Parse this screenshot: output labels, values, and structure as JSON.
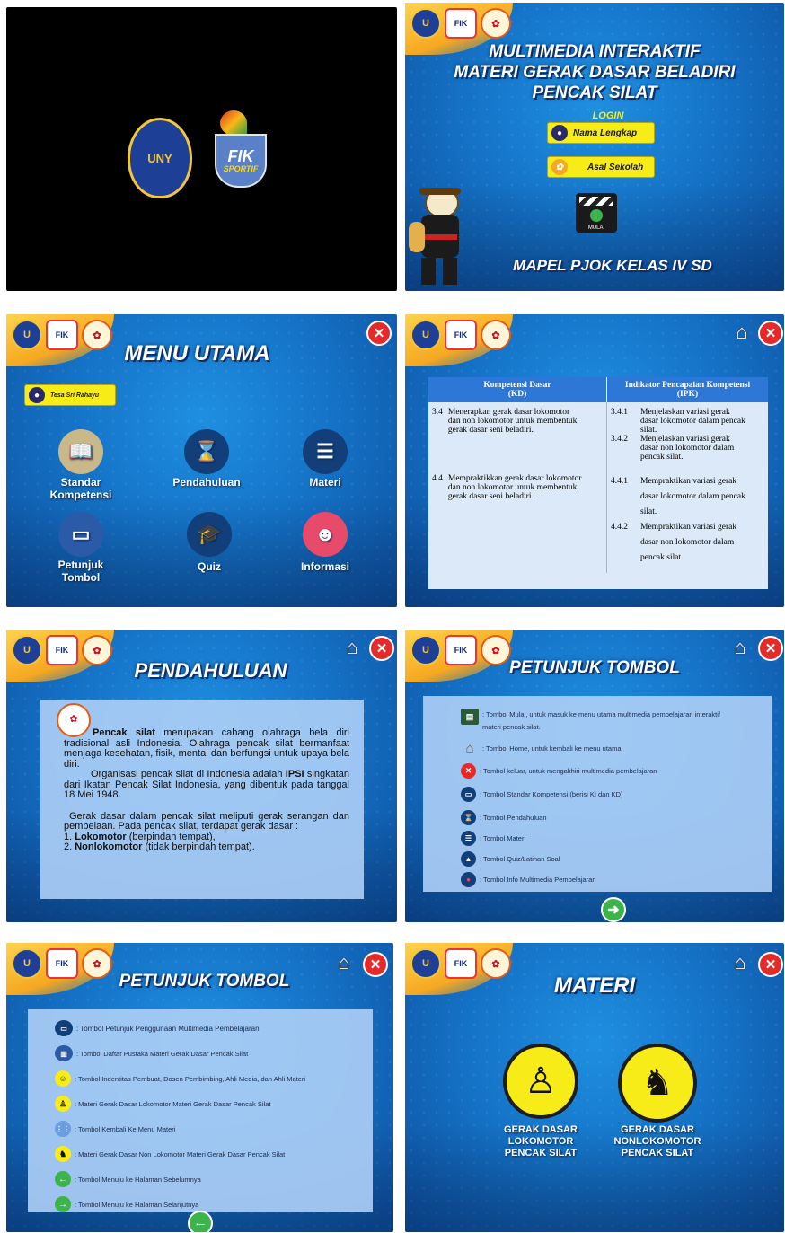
{
  "panel1": {
    "logo_uny": "UNY",
    "logo_fik_line1": "FIK",
    "logo_fik_line2": "SPORTIF"
  },
  "panel2": {
    "title": [
      "MULTIMEDIA INTERAKTIF",
      "MATERI GERAK DASAR BELADIRI",
      "PENCAK SILAT"
    ],
    "login_label": "LOGIN",
    "name_button": "Nama Lengkap",
    "school_button": "Asal Sekolah",
    "start_label": "MULAI",
    "footer": "MAPEL PJOK KELAS IV SD"
  },
  "panel3": {
    "title": "MENU UTAMA",
    "user_name": "Tesa Sri Rahayu",
    "items": [
      "Standar Kompetensi",
      "Pendahuluan",
      "Materi",
      "Petunjuk Tombol",
      "Quiz",
      "Informasi"
    ]
  },
  "panel4": {
    "head_kd": [
      "Kompetensi Dasar",
      "(KD)"
    ],
    "head_ipk": [
      "Indikator Pencapaian Kompetensi",
      "(IPK)"
    ],
    "rows": [
      {
        "kd_no": "3.4",
        "kd": "Menerapkan gerak dasar lokomotor dan non lokomotor untuk membentuk gerak dasar seni beladiri.",
        "ipk": [
          {
            "no": "3.4.1",
            "text": "Menjelaskan variasi gerak dasar lokomotor dalam pencak silat."
          },
          {
            "no": "3.4.2",
            "text": "Menjelaskan variasi gerak dasar non lokomotor dalam pencak silat."
          }
        ]
      },
      {
        "kd_no": "4.4",
        "kd": "Mempraktikkan gerak dasar lokomotor dan non lokomotor untuk membentuk gerak dasar seni beladiri.",
        "ipk": [
          {
            "no": "4.4.1",
            "text": "Mempraktikan variasi gerak dasar lokomotor dalam pencak silat."
          },
          {
            "no": "4.4.2",
            "text": "Mempraktikan variasi gerak dasar non lokomotor dalam pencak silat."
          }
        ]
      }
    ]
  },
  "panel5": {
    "title": "PENDAHULUAN",
    "p1_bold": "Pencak silat",
    "p1": " merupakan cabang olahraga bela diri tradisional asli Indonesia. Olahraga pencak silat bermanfaat menjaga kesehatan, fisik, mental dan berfungsi untuk upaya bela diri.",
    "p2_pre": "Organisasi pencak silat di Indonesia adalah ",
    "p2_bold": "IPSI",
    "p2_post": " singkatan dari Ikatan Pencak Silat Indonesia, yang dibentuk pada tanggal 18 Mei 1948.",
    "p3": "Gerak dasar dalam pencak silat meliputi gerak serangan dan pembelaan. Pada pencak silat, terdapat gerak dasar :",
    "li1_no": "1. ",
    "li1_bold": "Lokomotor",
    "li1": " (berpindah tempat),",
    "li2_no": "2. ",
    "li2_bold": "Nonlokomotor",
    "li2": " (tidak berpindah tempat)."
  },
  "panel6": {
    "title": "PETUNJUK TOMBOL",
    "items": [
      ": Tombol Mulai, untuk masuk ke menu utama multimedia pembelajaran interaktif materi pencak silat.",
      ": Tombol Home, untuk kembali ke menu utama",
      ": Tombol keluar, untuk mengakhiri multimedia pembelajaran",
      ": Tombol Standar Kompetensi (berisi KI dan KD)",
      ": Tombol Pendahuluan",
      ": Tombol Materi",
      ": Tombol Quiz/Latihan Soal",
      ": Tombol Info Multimedia Pembelajaran"
    ]
  },
  "panel7": {
    "title": "PETUNJUK TOMBOL",
    "items": [
      ": Tombol Petunjuk Penggunaan Multimedia Pembelajaran",
      ": Tombol Daftar Pustaka Materi Gerak Dasar Pencak Silat",
      ": Tombol Indentitas Pembuat, Dosen Pembimbing, Ahli Media, dan Ahli Materi",
      ": Materi Gerak Dasar Lokomotor Materi Gerak Dasar Pencak Silat",
      ": Tombol Kembali Ke Menu Materi",
      ": Materi Gerak Dasar Non Lokomotor Materi Gerak Dasar Pencak Silat",
      ": Tombol Menuju ke Halaman Sebelumnya",
      ": Tombol Menuju ke Halaman Selanjutnya"
    ]
  },
  "panel8": {
    "title": "MATERI",
    "left": [
      "GERAK DASAR",
      "LOKOMOTOR",
      "PENCAK SILAT"
    ],
    "right": [
      "GERAK DASAR",
      "NONLOKOMOTOR",
      "PENCAK SILAT"
    ]
  },
  "colors": {
    "accent_yellow": "#f8ec18",
    "close_red": "#e52a2a",
    "title_blue": "#0b2f6a",
    "box_blue": "#aacdf5"
  }
}
